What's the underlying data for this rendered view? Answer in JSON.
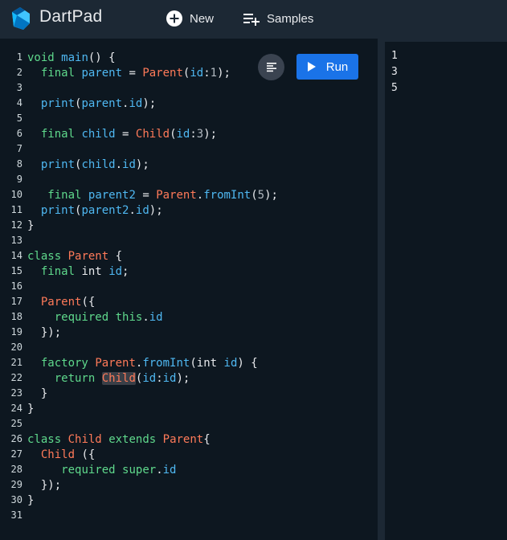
{
  "header": {
    "title": "DartPad",
    "new_label": "New",
    "samples_label": "Samples"
  },
  "editor": {
    "run_label": "Run",
    "line_numbers": [
      "1",
      "2",
      "3",
      "4",
      "5",
      "6",
      "7",
      "8",
      "9",
      "10",
      "11",
      "12",
      "13",
      "14",
      "15",
      "16",
      "17",
      "18",
      "19",
      "20",
      "21",
      "22",
      "23",
      "24",
      "25",
      "26",
      "27",
      "28",
      "29",
      "30",
      "31"
    ]
  },
  "console": {
    "output": [
      "1",
      "3",
      "5"
    ]
  },
  "colors": {
    "header_bg": "#1c2834",
    "editor_bg": "#0d1720",
    "run_button": "#1a73e8",
    "keyword": "#5fd98c",
    "type": "#ff7a59",
    "identifier": "#4fb8f2"
  },
  "icons": {
    "logo": "dart-logo-icon",
    "new": "add-circle-icon",
    "samples": "playlist-add-icon",
    "format": "format-align-icon",
    "run": "play-icon"
  }
}
